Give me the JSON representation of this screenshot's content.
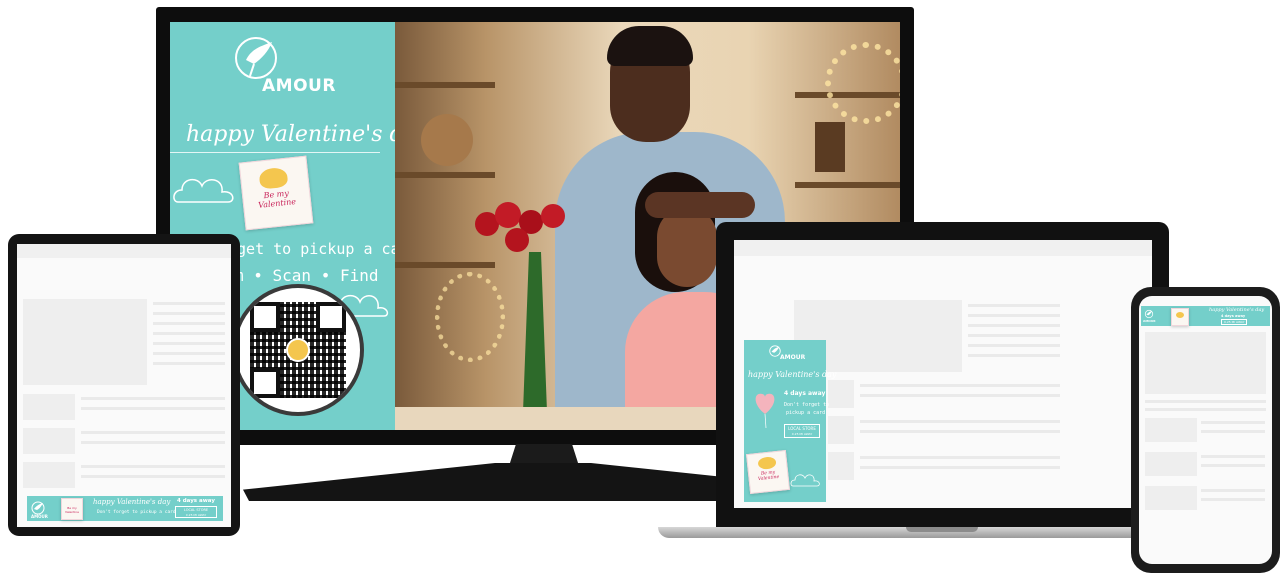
{
  "brand": {
    "name": "AMOUR",
    "colors": {
      "teal": "#74cfca",
      "bezel": "#0d0d0d"
    }
  },
  "tv_ad": {
    "headline": "happy Valentine's day",
    "card_text": "Be my Valentine",
    "line1": "rget to pickup a card",
    "line2": "m • Scan • Find"
  },
  "tablet_banner": {
    "brand": "AMOUR",
    "headline": "happy Valentine's day",
    "subline": "Don't forget to pickup a card",
    "countdown": "4 days away",
    "cta": "LOCAL STORE",
    "cta_sub": "0.25 MI AWAY",
    "card_text": "Be my Valentine"
  },
  "laptop_skyscraper": {
    "brand": "AMOUR",
    "headline": "happy Valentine's day",
    "countdown": "4 days away",
    "subline1": "Don't forget to",
    "subline2": "pickup a card",
    "cta": "LOCAL STORE",
    "cta_sub": "0.25 MI AWAY",
    "card_text": "Be my Valentine"
  },
  "phone_banner": {
    "brand": "AMOUR",
    "headline": "happy Valentine's day",
    "countdown": "4 days away",
    "cta": "0.25 MI AWAY"
  },
  "icons": [
    "dove-logo-icon",
    "cloud-icon",
    "heart-balloon-icon",
    "qr-code-icon",
    "ellipsis-menu-icon"
  ]
}
